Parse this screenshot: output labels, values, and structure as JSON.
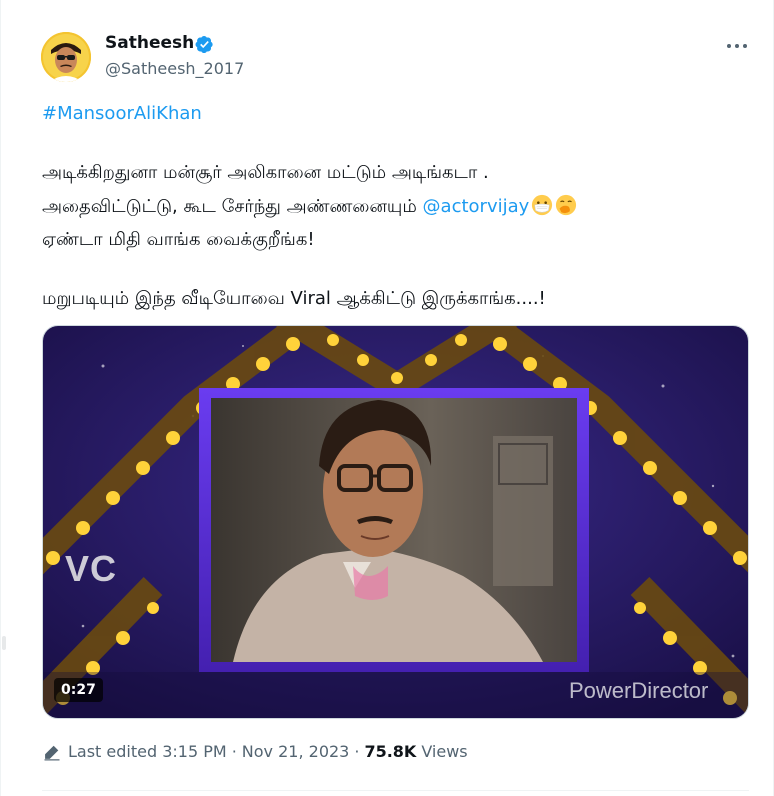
{
  "author": {
    "display_name": "Satheesh",
    "handle": "@Satheesh_2017",
    "verified": true,
    "avatar_icon": "avatar-photo"
  },
  "tweet": {
    "hashtag": "#MansoorAliKhan",
    "line1": "அடிக்கிறதுனா மன்சூர் அலிகானை மட்டும் அடிங்கடா .",
    "line2_prefix": "அதைவிட்டுட்டு, கூட சேர்ந்து அண்ணனையும் ",
    "mention": "@actorvijay",
    "line3": "ஏண்டா மிதி  வாங்க வைக்குறீங்க!",
    "line4": "மறுபடியும் இந்த வீடியோவை Viral ஆக்கிட்டு இருக்காங்க....!",
    "emojis": [
      "face-with-medical-mask",
      "face-with-hand-over-mouth"
    ]
  },
  "media": {
    "type": "video",
    "duration": "0:27",
    "overlay_text": "VC",
    "watermark": "PowerDirector"
  },
  "footer": {
    "edit_label": "Last edited",
    "time": "3:15 PM",
    "separator": "·",
    "date": "Nov 21, 2023",
    "views_count": "75.8K",
    "views_label": "Views"
  },
  "colors": {
    "accent": "#1d9bf0",
    "text": "#0f1419",
    "secondary_text": "#536471",
    "stage_purple": "#2b1a6b",
    "frame_purple": "#5a2bd6",
    "bulb_yellow": "#ffd23a"
  }
}
